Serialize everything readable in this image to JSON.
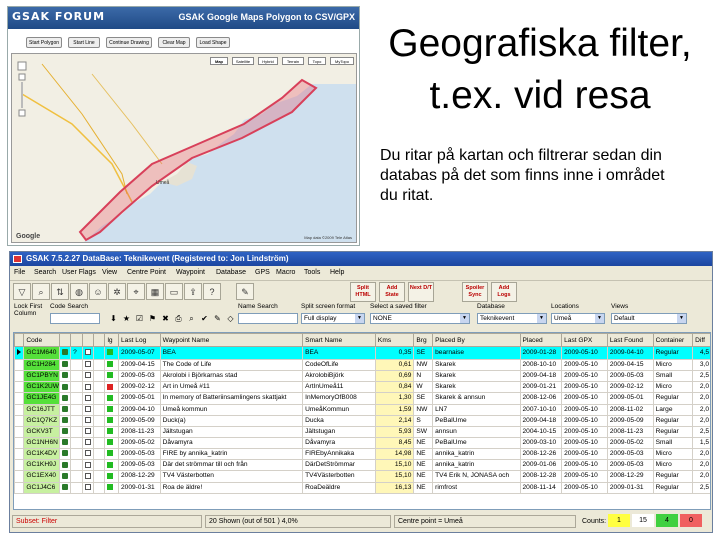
{
  "slide": {
    "title_line1": "Geografiska filter,",
    "title_line2": "t.ex. vid resa",
    "body": "Du ritar på kartan och filtrerar sedan din databas på det som finns inne i området du ritat."
  },
  "forum": {
    "logo": "GSAK FORUM",
    "app_title": "GSAK Google Maps Polygon to CSV/GPX",
    "buttons": [
      "Start Polygon",
      "Start Line",
      "Continue Drawing",
      "Clear Map",
      "Load Shape"
    ],
    "map_types": [
      "Map",
      "Satellite",
      "Hybrid",
      "Terrain",
      "Topo",
      "MyTopo"
    ],
    "map_town": "Umeå",
    "google": "Google",
    "copyright": "Map data ©2009 Tele Atlas"
  },
  "app": {
    "title": "GSAK 7.5.2.27   DataBase: Teknikevent   (Registered to: Jon Lindström)",
    "menu": [
      "File",
      "Search",
      "User Flags",
      "View",
      "Centre Point",
      "Waypoint",
      "Database",
      "GPS",
      "Macro",
      "Tools",
      "Help"
    ],
    "toolbar_text_buttons": [
      "Split HTML",
      "Add State",
      "Next D/T",
      "Spoiler Sync",
      "Add Logs"
    ],
    "controls": {
      "lock_first": "Lock First Column",
      "code_search": "Code Search",
      "name_search": "Name Search",
      "split_screen_label": "Split screen format",
      "split_screen_value": "Full display",
      "saved_filter_label": "Select a saved filter",
      "saved_filter_value": "NONE",
      "database_label": "Database",
      "database_value": "Teknikevent",
      "locations_label": "Locations",
      "locations_value": "Umeå",
      "views_label": "Views",
      "views_value": "Default"
    },
    "columns": [
      "",
      "Code",
      "",
      "",
      "",
      "",
      "lg",
      "Last Log",
      "Waypoint Name",
      "Smart Name",
      "Kms",
      "Brg",
      "Placed By",
      "Placed",
      "Last GPX",
      "Last Found",
      "Container",
      "Diff"
    ],
    "rows": [
      {
        "code": "GC1M640",
        "last_log": "2009-05-07",
        "name": "BEA",
        "smart": "BEA",
        "kms": "0,35",
        "brg": "SE",
        "placed_by": "bearnaise",
        "placed": "2009-01-28",
        "gpx": "2009-05-10",
        "found": "2009-04-10",
        "container": "Regular",
        "diff": "4,5",
        "tone": "g"
      },
      {
        "code": "GC1H284",
        "last_log": "2009-04-15",
        "name": "The Code of Life",
        "smart": "CodeOfLife",
        "kms": "0,61",
        "brg": "NW",
        "placed_by": "Skarek",
        "placed": "2008-10-10",
        "gpx": "2009-05-10",
        "found": "2009-04-15",
        "container": "Micro",
        "diff": "3,0",
        "tone": "g"
      },
      {
        "code": "GC1PBYN",
        "last_log": "2009-05-03",
        "name": "Akrolobi i Björkarnas stad",
        "smart": "AkrolobiBjörk",
        "kms": "0,69",
        "brg": "N",
        "placed_by": "Skarek",
        "placed": "2009-04-18",
        "gpx": "2009-05-10",
        "found": "2009-05-03",
        "container": "Small",
        "diff": "2,5",
        "tone": "g"
      },
      {
        "code": "GC1K2UW",
        "last_log": "2009-02-12",
        "name": "Art in Umeå #11",
        "smart": "ArtInUmeå11",
        "kms": "0,84",
        "brg": "W",
        "placed_by": "Skarek",
        "placed": "2009-01-21",
        "gpx": "2009-05-10",
        "found": "2009-02-12",
        "container": "Micro",
        "diff": "2,0",
        "tone": "g"
      },
      {
        "code": "GC1JE4G",
        "last_log": "2009-05-01",
        "name": "In memory of Batteriinsamlingens skattjakt",
        "smart": "InMemoryOfB008",
        "kms": "1,30",
        "brg": "SE",
        "placed_by": "Skarek & annsun",
        "placed": "2008-12-06",
        "gpx": "2009-05-10",
        "found": "2009-05-01",
        "container": "Regular",
        "diff": "2,0",
        "tone": "g"
      },
      {
        "code": "GC16JTT",
        "last_log": "2009-04-10",
        "name": "Umeå kommun",
        "smart": "UmeåKommun",
        "kms": "1,59",
        "brg": "NW",
        "placed_by": "LN7",
        "placed": "2007-10-10",
        "gpx": "2009-05-10",
        "found": "2008-11-02",
        "container": "Large",
        "diff": "2,0",
        "tone": ""
      },
      {
        "code": "GC1Q7KZ",
        "last_log": "2009-05-09",
        "name": "Duck(a)",
        "smart": "Ducka",
        "kms": "2,14",
        "brg": "S",
        "placed_by": "PeBalUme",
        "placed": "2009-04-18",
        "gpx": "2009-05-10",
        "found": "2009-05-09",
        "container": "Regular",
        "diff": "2,0",
        "tone": ""
      },
      {
        "code": "GCKV3T",
        "last_log": "2008-11-23",
        "name": "Jältstugan",
        "smart": "Jältstugan",
        "kms": "5,93",
        "brg": "SW",
        "placed_by": "annsun",
        "placed": "2004-10-15",
        "gpx": "2009-05-10",
        "found": "2008-11-23",
        "container": "Regular",
        "diff": "2,5",
        "tone": ""
      },
      {
        "code": "GC1NH6N",
        "last_log": "2009-05-02",
        "name": "Dåvamyra",
        "smart": "Dåvamyra",
        "kms": "8,45",
        "brg": "NE",
        "placed_by": "PeBalUme",
        "placed": "2009-03-10",
        "gpx": "2009-05-10",
        "found": "2009-05-02",
        "container": "Small",
        "diff": "1,5",
        "tone": ""
      },
      {
        "code": "GC1K4DV",
        "last_log": "2009-05-03",
        "name": "FIRE by annika_katrin",
        "smart": "FIREbyAnnikaka",
        "kms": "14,98",
        "brg": "NE",
        "placed_by": "annika_katrin",
        "placed": "2008-12-26",
        "gpx": "2009-05-10",
        "found": "2009-05-03",
        "container": "Micro",
        "diff": "2,0",
        "tone": ""
      },
      {
        "code": "GC1KH9J",
        "last_log": "2009-05-03",
        "name": "Där det strömmar till och från",
        "smart": "DärDetStrömmar",
        "kms": "15,10",
        "brg": "NE",
        "placed_by": "annika_katrin",
        "placed": "2009-01-06",
        "gpx": "2009-05-10",
        "found": "2009-05-03",
        "container": "Micro",
        "diff": "2,0",
        "tone": ""
      },
      {
        "code": "GC1EX40",
        "last_log": "2008-12-29",
        "name": "TV4 Västerbotten",
        "smart": "TV4Västerbotten",
        "kms": "15,10",
        "brg": "NE",
        "placed_by": "TV4 Erik N, JONASA och",
        "placed": "2008-12-28",
        "gpx": "2009-05-10",
        "found": "2008-12-29",
        "container": "Regular",
        "diff": "2,0",
        "tone": ""
      },
      {
        "code": "GC1J4C6",
        "last_log": "2009-01-31",
        "name": "Roa de äldre!",
        "smart": "RoaDeäldre",
        "kms": "16,13",
        "brg": "NE",
        "placed_by": "rimfrost",
        "placed": "2008-11-14",
        "gpx": "2009-05-10",
        "found": "2009-01-31",
        "container": "Regular",
        "diff": "2,5",
        "tone": ""
      }
    ],
    "status": {
      "subset": "Subset: Filter",
      "shown": "20 Shown (out of 501 )  4,0%",
      "centre": "Centre point = Umeå",
      "counts_label": "Counts:",
      "counts": [
        "1",
        "15",
        "4",
        "0"
      ]
    }
  }
}
